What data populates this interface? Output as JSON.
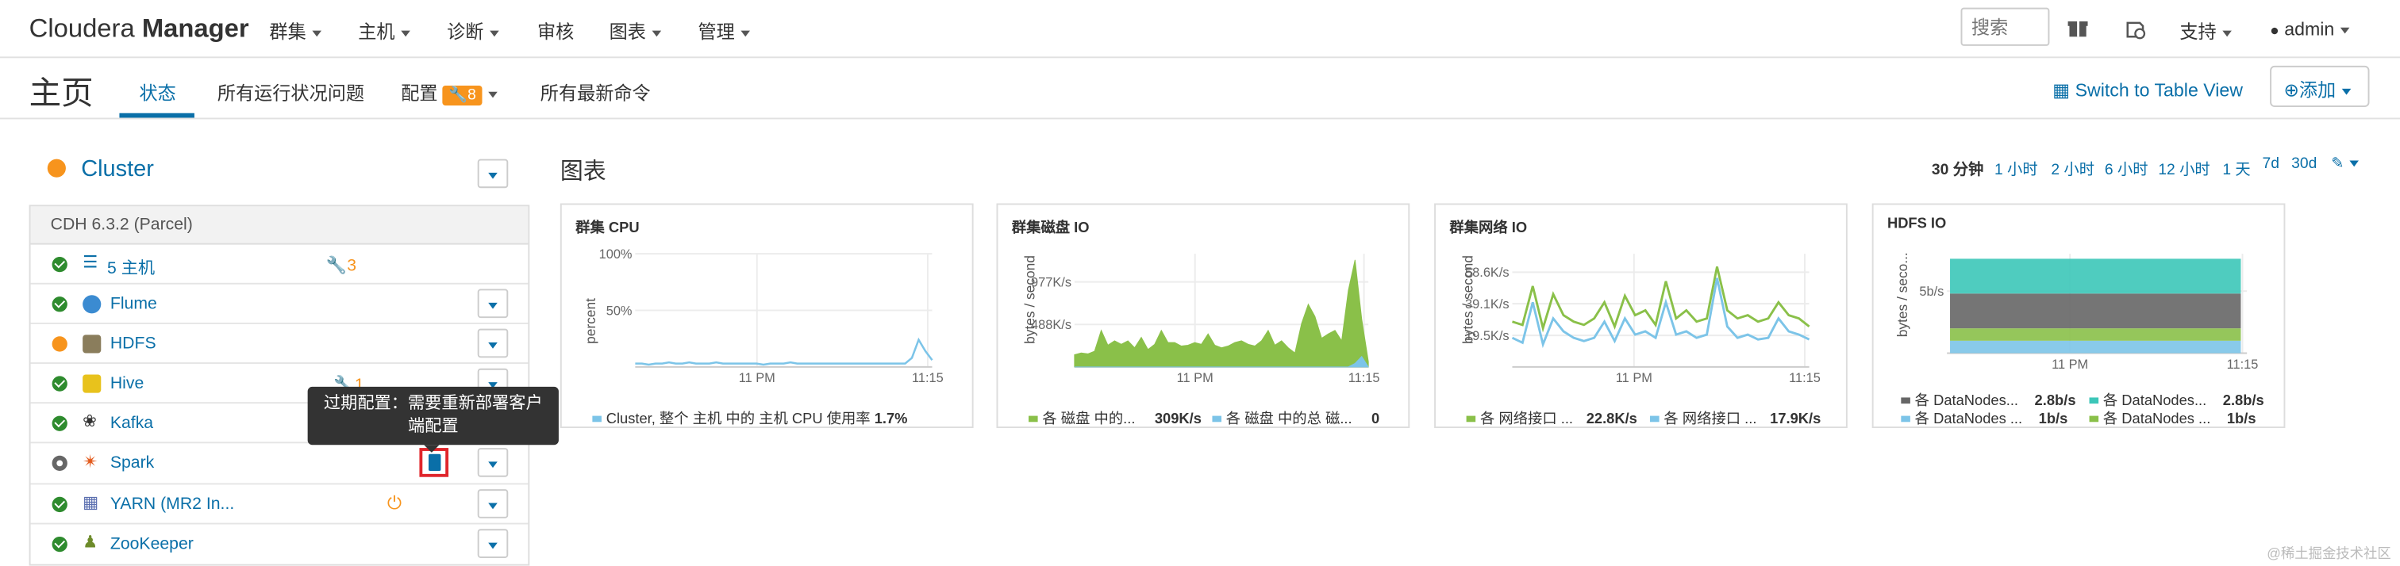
{
  "brand": {
    "name_light": "Cloudera ",
    "name_bold": "Manager"
  },
  "nav": {
    "items": [
      "群集",
      "主机",
      "诊断",
      "审核",
      "图表",
      "管理"
    ],
    "search_placeholder": "搜索",
    "support": "支持",
    "user": "admin"
  },
  "subheader": {
    "title": "主页",
    "tabs": [
      "状态",
      "所有运行状况问题",
      "配置",
      "所有最新命令"
    ],
    "config_badge": "8",
    "switch_view": "Switch to Table View",
    "add": "添加"
  },
  "cluster": {
    "name": "Cluster",
    "version": "CDH 6.3.2 (Parcel)",
    "status_color": "#f7941d",
    "rows": [
      {
        "name": "5 主机",
        "status": "ok",
        "badge": "3",
        "icon": "list-icon"
      },
      {
        "name": "Flume",
        "status": "ok",
        "icon": "flume-icon"
      },
      {
        "name": "HDFS",
        "status": "warn",
        "icon": "hdfs-icon"
      },
      {
        "name": "Hive",
        "status": "ok",
        "badge": "1",
        "icon": "hive-icon"
      },
      {
        "name": "Kafka",
        "status": "ok",
        "icon": "kafka-icon"
      },
      {
        "name": "Spark",
        "status": "stopped",
        "icon": "spark-icon"
      },
      {
        "name": "YARN (MR2 In...",
        "status": "ok",
        "icon": "yarn-icon"
      },
      {
        "name": "ZooKeeper",
        "status": "ok",
        "icon": "zookeeper-icon"
      }
    ],
    "tooltip": "过期配置：需要重新部署客户端配置"
  },
  "charts_header": {
    "title": "图表",
    "ranges": [
      "30 分钟",
      "1 小时",
      "2 小时",
      "6 小时",
      "12 小时",
      "1 天",
      "7d",
      "30d"
    ],
    "active_range": "30 分钟"
  },
  "chart_data": [
    {
      "type": "line",
      "title": "群集 CPU",
      "ylabel": "percent",
      "yticks": [
        "100%",
        "50%"
      ],
      "xticks": [
        "11 PM",
        "11:15"
      ],
      "series": [
        {
          "name": "Cluster, 整个 主机 中的 主机 CPU 使用率",
          "value_label": "1.7%",
          "color": "#7cc4e8",
          "values": [
            3,
            3,
            2,
            3,
            3,
            4,
            3,
            3,
            4,
            3,
            3,
            3,
            4,
            3,
            3,
            3,
            3,
            3,
            3,
            2,
            3,
            3,
            3,
            4,
            3,
            3,
            3,
            3,
            3,
            3,
            3,
            3,
            3,
            3,
            3,
            3,
            3,
            3,
            3,
            3,
            3,
            8,
            24,
            14,
            6
          ]
        }
      ]
    },
    {
      "type": "area",
      "title": "群集磁盘 IO",
      "ylabel": "bytes / second",
      "yticks": [
        "977K/s",
        "488K/s"
      ],
      "xticks": [
        "11 PM",
        "11:15"
      ],
      "series": [
        {
          "name": "各 磁盘 中的...",
          "value_label": "309K/s",
          "color": "#8ac049",
          "values": [
            140,
            160,
            150,
            180,
            420,
            250,
            300,
            260,
            300,
            220,
            340,
            200,
            260,
            420,
            280,
            280,
            240,
            250,
            280,
            260,
            380,
            250,
            220,
            240,
            280,
            300,
            260,
            240,
            300,
            420,
            250,
            300,
            220,
            160,
            500,
            720,
            580,
            330,
            380,
            420,
            300,
            880,
            1230,
            550,
            60
          ]
        },
        {
          "name": "各 磁盘 中的总 磁...",
          "value_label": "0",
          "color": "#7cc4e8",
          "values": [
            0,
            0,
            0,
            0,
            0,
            0,
            0,
            0,
            0,
            0,
            0,
            0,
            0,
            0,
            0,
            0,
            0,
            0,
            0,
            0,
            0,
            0,
            0,
            0,
            0,
            0,
            0,
            0,
            0,
            0,
            0,
            0,
            0,
            0,
            0,
            0,
            0,
            0,
            0,
            0,
            0,
            0,
            40,
            120,
            0
          ]
        }
      ]
    },
    {
      "type": "line",
      "title": "群集网络 IO",
      "ylabel": "bytes / second",
      "yticks": [
        "58.6K/s",
        "39.1K/s",
        "19.5K/s"
      ],
      "xticks": [
        "11 PM",
        "11:15"
      ],
      "series": [
        {
          "name": "各 网络接口 ...",
          "value_label": "22.8K/s",
          "color": "#8ac049",
          "values": [
            28,
            26,
            50,
            24,
            45,
            32,
            28,
            26,
            30,
            40,
            25,
            44,
            32,
            35,
            26,
            53,
            30,
            35,
            28,
            30,
            62,
            35,
            30,
            32,
            28,
            30,
            40,
            32,
            30,
            25
          ]
        },
        {
          "name": "各 网络接口 ...",
          "value_label": "17.9K/s",
          "color": "#7cc4e8",
          "values": [
            18,
            15,
            40,
            14,
            30,
            22,
            18,
            16,
            18,
            28,
            16,
            30,
            20,
            22,
            18,
            40,
            20,
            22,
            18,
            20,
            55,
            25,
            18,
            20,
            17,
            18,
            30,
            22,
            20,
            17
          ]
        }
      ]
    },
    {
      "type": "area",
      "title": "HDFS IO",
      "ylabel": "bytes / seco...",
      "yticks": [
        "5b/s"
      ],
      "xticks": [
        "11 PM",
        "11:15"
      ],
      "series": [
        {
          "name": "各 DataNodes...",
          "value_label": "2.8b/s",
          "color": "#666666",
          "values": [
            2.8,
            2.8
          ]
        },
        {
          "name": "各 DataNodes...",
          "value_label": "2.8b/s",
          "color": "#3cc6b8",
          "values": [
            2.8,
            2.8
          ]
        },
        {
          "name": "各 DataNodes ...",
          "value_label": "1b/s",
          "color": "#7cc4e8",
          "values": [
            1,
            1
          ]
        },
        {
          "name": "各 DataNodes ...",
          "value_label": "1b/s",
          "color": "#8ac049",
          "values": [
            1,
            1
          ]
        }
      ]
    }
  ],
  "watermark": "@稀土掘金技术社区"
}
